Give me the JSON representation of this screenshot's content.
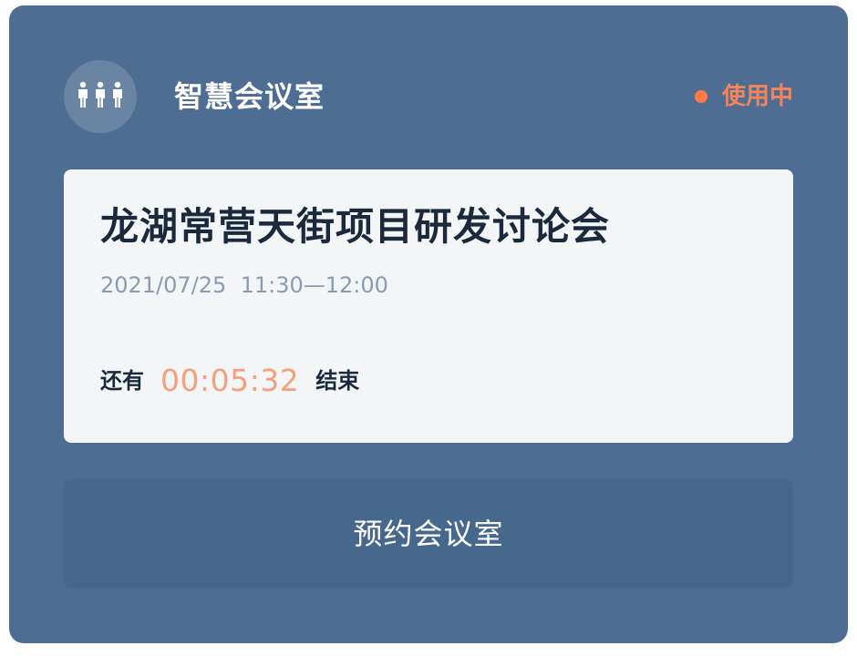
{
  "header": {
    "room_icon": "people-group-icon",
    "room_name": "智慧会议室",
    "status_text": "使用中",
    "status_color": "#ff7a45"
  },
  "meeting": {
    "title": "龙湖常营天街项目研发讨论会",
    "time": "2021/07/25  11:30—12:00",
    "countdown_prefix": "还有",
    "countdown_value": "00:05:32",
    "countdown_suffix": "结束"
  },
  "actions": {
    "book_label": "预约会议室"
  },
  "colors": {
    "card_background": "#4e6d93",
    "panel_background": "#f4f5f7",
    "button_background": "#46688d",
    "countdown": "#f4a07c"
  }
}
